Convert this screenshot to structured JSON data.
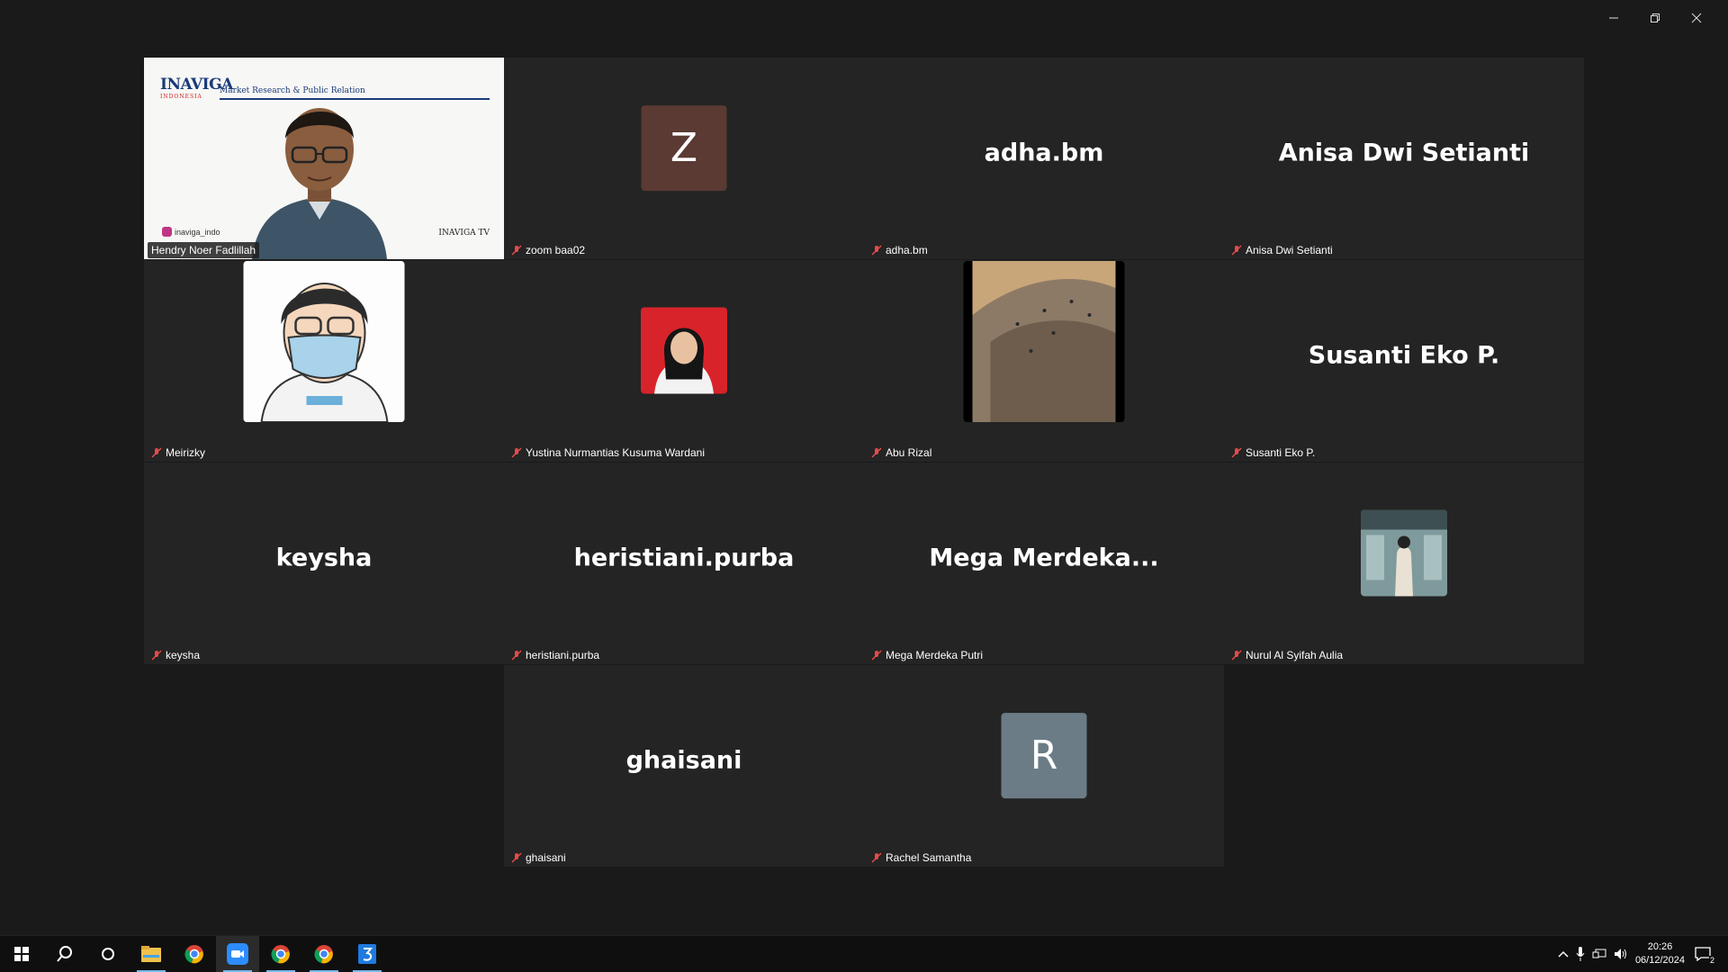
{
  "window": {
    "controls": [
      "minimize",
      "restore",
      "close"
    ]
  },
  "presenter": {
    "name": "Hendry Noer Fadlillah",
    "slide_brand": "INAVIGA",
    "slide_sub": "INDONESIA",
    "slide_title": "Market Research & Public Relation",
    "slide_social": "inaviga_indo",
    "slide_footer": "INAVIGA TV"
  },
  "tiles": [
    {
      "label": "zoom baa02",
      "letter": "Z",
      "letter_bg": "#5a3a33"
    },
    {
      "label": "adha.bm",
      "display": "adha.bm"
    },
    {
      "label": "Anisa Dwi Setianti",
      "display": "Anisa Dwi Setianti"
    },
    {
      "label": "Meirizky"
    },
    {
      "label": "Yustina Nurmantias Kusuma Wardani"
    },
    {
      "label": "Abu Rizal"
    },
    {
      "label": "Susanti Eko P.",
      "display": "Susanti Eko P."
    },
    {
      "label": "keysha",
      "display": "keysha"
    },
    {
      "label": "heristiani.purba",
      "display": "heristiani.purba"
    },
    {
      "label": "Mega Merdeka Putri",
      "display": "Mega  Merdeka..."
    },
    {
      "label": "Nurul Al Syifah Aulia"
    },
    {
      "label": "ghaisani",
      "display": "ghaisani"
    },
    {
      "label": "Rachel Samantha",
      "letter": "R",
      "letter_bg": "#6b7c87"
    }
  ],
  "taskbar": {
    "apps": [
      "start-icon",
      "search-icon",
      "task-view-icon",
      "file-explorer-icon",
      "chrome-icon",
      "zoom-icon",
      "chrome-icon",
      "chrome-icon",
      "app-icon"
    ],
    "clock_time": "20:26",
    "clock_date": "06/12/2024",
    "notification_count": "2"
  }
}
